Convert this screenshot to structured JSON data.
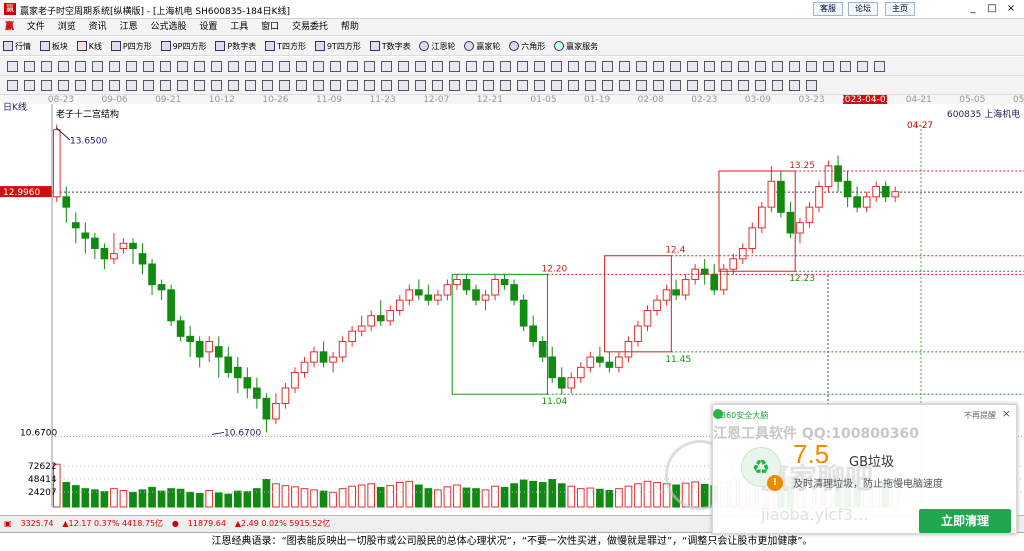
{
  "window": {
    "title": "赢家老子时空周期系统[纵横版] - [上海机电  SH600835-184日K线]",
    "links": [
      "客服",
      "论坛",
      "主页"
    ],
    "controls": [
      "_",
      "□",
      "×"
    ]
  },
  "menu": [
    "文件",
    "浏览",
    "资讯",
    "江恩",
    "公式选股",
    "设置",
    "工具",
    "窗口",
    "交易委托",
    "帮助"
  ],
  "toolbar1": [
    "行情",
    "板块",
    "K线",
    "P四方形",
    "9P四方形",
    "P数字表",
    "T四方形",
    "9T四方形",
    "T数字表",
    "江恩轮",
    "赢家轮",
    "六角形",
    "赢家服务"
  ],
  "chart": {
    "period_label": "日K线",
    "indicator_title": "老子十二宫结构",
    "stock_code": "600835",
    "stock_name": "上海机电",
    "date_ticks": [
      "08-23",
      "09-06",
      "09-21",
      "10-12",
      "10-26",
      "11-09",
      "11-23",
      "12-07",
      "12-21",
      "01-05",
      "01-19",
      "02-08",
      "02-23",
      "03-09",
      "03-23",
      "2023-04-03",
      "04-21",
      "05-05",
      "05-19"
    ],
    "highlight_date": "2023-04-03",
    "vline_date": "04-27",
    "current_price": "12.9960",
    "high_label": "13.6500",
    "low_label": "10.6700",
    "low_axis": "10.6700",
    "box_levels": [
      {
        "text": "12.20",
        "color": "#d02020"
      },
      {
        "text": "11.04",
        "color": "#189018"
      },
      {
        "text": "11.45",
        "color": "#189018"
      },
      {
        "text": "12.4",
        "color": "#d02020"
      },
      {
        "text": "13.25",
        "color": "#d02020"
      },
      {
        "text": "12.23",
        "color": "#189018"
      }
    ],
    "volume_labels": [
      "72622",
      "48414",
      "24207"
    ],
    "colors": {
      "up": "#e03030",
      "down": "#108a10",
      "bg": "#ffffff"
    }
  },
  "chart_data": {
    "type": "candlestick",
    "title": "老子十二宫结构",
    "ylim": [
      10.5,
      13.8
    ],
    "candles": [
      [
        12.95,
        13.65,
        13.6,
        12.9
      ],
      [
        12.95,
        13.05,
        12.85,
        12.7
      ],
      [
        12.7,
        12.8,
        12.65,
        12.5
      ],
      [
        12.6,
        12.7,
        12.55,
        12.4
      ],
      [
        12.55,
        12.6,
        12.45,
        12.35
      ],
      [
        12.45,
        12.5,
        12.35,
        12.25
      ],
      [
        12.35,
        12.6,
        12.4,
        12.3
      ],
      [
        12.45,
        12.55,
        12.5,
        12.4
      ],
      [
        12.5,
        12.55,
        12.45,
        12.3
      ],
      [
        12.4,
        12.5,
        12.3,
        12.2
      ],
      [
        12.3,
        12.35,
        12.1,
        12.0
      ],
      [
        12.1,
        12.15,
        12.05,
        11.95
      ],
      [
        12.05,
        12.1,
        11.75,
        11.7
      ],
      [
        11.75,
        11.8,
        11.6,
        11.55
      ],
      [
        11.6,
        11.7,
        11.55,
        11.4
      ],
      [
        11.55,
        11.6,
        11.4,
        11.3
      ],
      [
        11.45,
        11.6,
        11.55,
        11.35
      ],
      [
        11.5,
        11.6,
        11.4,
        11.2
      ],
      [
        11.4,
        11.5,
        11.25,
        11.2
      ],
      [
        11.3,
        11.4,
        11.2,
        11.05
      ],
      [
        11.2,
        11.3,
        11.1,
        11.0
      ],
      [
        11.1,
        11.2,
        11.0,
        10.9
      ],
      [
        11.0,
        11.05,
        10.8,
        10.67
      ],
      [
        10.8,
        11.05,
        10.95,
        10.75
      ],
      [
        10.95,
        11.15,
        11.1,
        10.9
      ],
      [
        11.1,
        11.3,
        11.25,
        11.05
      ],
      [
        11.25,
        11.4,
        11.35,
        11.2
      ],
      [
        11.35,
        11.5,
        11.45,
        11.3
      ],
      [
        11.45,
        11.55,
        11.35,
        11.3
      ],
      [
        11.35,
        11.45,
        11.4,
        11.25
      ],
      [
        11.4,
        11.6,
        11.55,
        11.35
      ],
      [
        11.55,
        11.7,
        11.65,
        11.5
      ],
      [
        11.65,
        11.8,
        11.7,
        11.6
      ],
      [
        11.7,
        11.85,
        11.8,
        11.65
      ],
      [
        11.8,
        11.95,
        11.75,
        11.7
      ],
      [
        11.75,
        11.9,
        11.85,
        11.7
      ],
      [
        11.85,
        12.0,
        11.95,
        11.8
      ],
      [
        11.95,
        12.1,
        12.05,
        11.9
      ],
      [
        12.05,
        12.15,
        12.0,
        11.95
      ],
      [
        12.0,
        12.1,
        11.95,
        11.9
      ],
      [
        11.95,
        12.05,
        12.0,
        11.9
      ],
      [
        12.0,
        12.15,
        12.1,
        11.95
      ],
      [
        12.1,
        12.2,
        12.15,
        12.05
      ],
      [
        12.15,
        12.2,
        12.05,
        12.0
      ],
      [
        12.05,
        12.1,
        11.95,
        11.9
      ],
      [
        11.95,
        12.05,
        12.0,
        11.85
      ],
      [
        12.0,
        12.2,
        12.15,
        11.95
      ],
      [
        12.15,
        12.2,
        12.1,
        12.05
      ],
      [
        12.1,
        12.15,
        11.95,
        11.9
      ],
      [
        11.95,
        12.0,
        11.7,
        11.65
      ],
      [
        11.7,
        11.8,
        11.55,
        11.5
      ],
      [
        11.55,
        11.6,
        11.4,
        11.35
      ],
      [
        11.4,
        11.5,
        11.2,
        11.15
      ],
      [
        11.2,
        11.3,
        11.1,
        11.04
      ],
      [
        11.1,
        11.25,
        11.2,
        11.05
      ],
      [
        11.2,
        11.35,
        11.3,
        11.15
      ],
      [
        11.3,
        11.45,
        11.4,
        11.25
      ],
      [
        11.4,
        11.5,
        11.35,
        11.3
      ],
      [
        11.35,
        11.45,
        11.3,
        11.25
      ],
      [
        11.3,
        11.45,
        11.4,
        11.25
      ],
      [
        11.4,
        11.6,
        11.55,
        11.35
      ],
      [
        11.55,
        11.75,
        11.7,
        11.5
      ],
      [
        11.7,
        11.9,
        11.85,
        11.65
      ],
      [
        11.85,
        12.0,
        11.95,
        11.8
      ],
      [
        11.95,
        12.1,
        12.05,
        11.9
      ],
      [
        12.05,
        12.15,
        12.0,
        11.95
      ],
      [
        12.0,
        12.2,
        12.15,
        11.95
      ],
      [
        12.15,
        12.3,
        12.25,
        12.1
      ],
      [
        12.25,
        12.35,
        12.2,
        12.1
      ],
      [
        12.2,
        12.3,
        12.05,
        12.0
      ],
      [
        12.05,
        12.3,
        12.25,
        12.0
      ],
      [
        12.25,
        12.4,
        12.35,
        12.2
      ],
      [
        12.35,
        12.5,
        12.45,
        12.3
      ],
      [
        12.45,
        12.7,
        12.65,
        12.4
      ],
      [
        12.65,
        12.9,
        12.85,
        12.6
      ],
      [
        12.85,
        13.25,
        13.1,
        12.8
      ],
      [
        13.1,
        13.2,
        12.8,
        12.75
      ],
      [
        12.8,
        12.9,
        12.6,
        12.55
      ],
      [
        12.6,
        12.75,
        12.7,
        12.5
      ],
      [
        12.7,
        12.9,
        12.85,
        12.65
      ],
      [
        12.85,
        13.1,
        13.05,
        12.8
      ],
      [
        13.05,
        13.3,
        13.25,
        13.0
      ],
      [
        13.25,
        13.35,
        13.1,
        13.0
      ],
      [
        13.1,
        13.2,
        12.95,
        12.85
      ],
      [
        12.95,
        13.05,
        12.85,
        12.8
      ],
      [
        12.85,
        13.0,
        12.95,
        12.8
      ],
      [
        12.95,
        13.1,
        13.05,
        12.9
      ],
      [
        13.05,
        13.1,
        12.95,
        12.9
      ],
      [
        12.95,
        13.05,
        13.0,
        12.9
      ]
    ],
    "volumes": [
      70,
      40,
      35,
      30,
      28,
      25,
      30,
      27,
      24,
      28,
      32,
      26,
      30,
      29,
      24,
      22,
      27,
      23,
      21,
      26,
      25,
      30,
      45,
      38,
      35,
      33,
      30,
      28,
      26,
      24,
      30,
      34,
      36,
      38,
      32,
      35,
      40,
      42,
      36,
      30,
      28,
      33,
      36,
      31,
      30,
      28,
      34,
      32,
      38,
      44,
      42,
      40,
      45,
      38,
      34,
      30,
      31,
      29,
      27,
      30,
      34,
      38,
      42,
      40,
      38,
      36,
      39,
      41,
      37,
      35,
      40,
      44,
      48,
      55,
      62,
      72,
      58,
      50,
      45,
      48,
      52,
      60,
      55,
      48,
      45,
      40,
      43,
      41,
      39
    ]
  },
  "status": {
    "items": [
      {
        "label": "3325.74",
        "change": "▲12.17 0.37% 4418.75亿"
      },
      {
        "label": "11879.64",
        "change": "▲2.49 0.02% 5915.52亿"
      }
    ]
  },
  "quote": "江恩经典语录：“图表能反映出一切股市或公司股民的总体心理状况”，“不要一次性买进，做慢就是罪过”，“调整只会让股市更加健康”。",
  "popup": {
    "header": "360安全大脑",
    "no_remind": "不再提醒",
    "close": "×",
    "watermark1": "江恩工具软件  QQ:100800360",
    "amount": "7.5",
    "unit": "GB垃圾",
    "desc": "及时清理垃圾，防止拖慢电脑速度",
    "button": "立即清理",
    "watermark2": "赢家聊吧",
    "watermark3": "jiaoba.yicf3..."
  }
}
